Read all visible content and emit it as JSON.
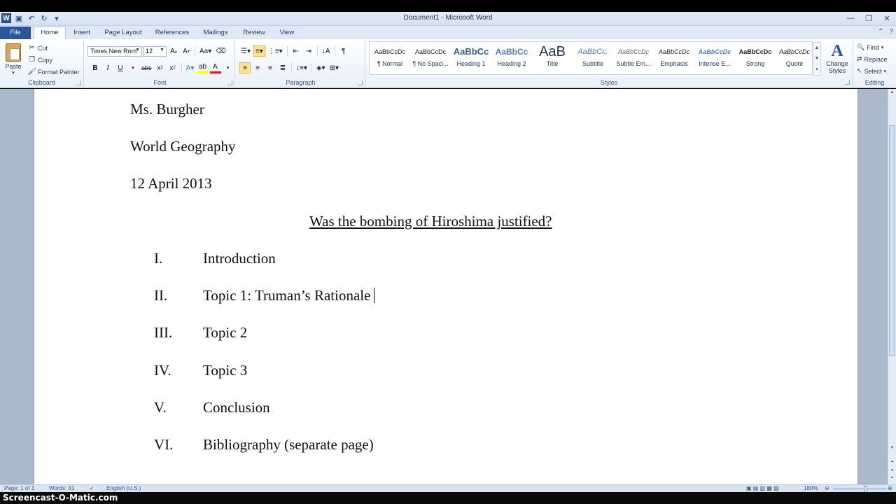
{
  "window": {
    "title": "Document1  -  Microsoft Word",
    "qat_icons": [
      "word-logo-icon",
      "save-icon",
      "undo-icon",
      "redo-icon",
      "customize-qat-icon"
    ],
    "controls": [
      "—",
      "❐",
      "✕"
    ]
  },
  "tabs": [
    "File",
    "Home",
    "Insert",
    "Page Layout",
    "References",
    "Mailings",
    "Review",
    "View"
  ],
  "active_tab": "Home",
  "ribbon": {
    "clipboard": {
      "label": "Clipboard",
      "paste": "Paste",
      "cut": "Cut",
      "copy": "Copy",
      "format_painter": "Format Painter"
    },
    "font": {
      "label": "Font",
      "font_name": "Times New Rom",
      "font_size": "12"
    },
    "paragraph": {
      "label": "Paragraph"
    },
    "styles": {
      "label": "Styles",
      "tiles": [
        {
          "sample": "AaBbCcDc",
          "name": "¶ Normal"
        },
        {
          "sample": "AaBbCcDc",
          "name": "¶ No Spaci..."
        },
        {
          "sample": "AaBbCc",
          "name": "Heading 1"
        },
        {
          "sample": "AaBbCc",
          "name": "Heading 2"
        },
        {
          "sample": "AaB",
          "name": "Title"
        },
        {
          "sample": "AaBbCc.",
          "name": "Subtitle"
        },
        {
          "sample": "AaBbCcDc",
          "name": "Subtle Em..."
        },
        {
          "sample": "AaBbCcDc",
          "name": "Emphasis"
        },
        {
          "sample": "AaBbCcDc",
          "name": "Intense E..."
        },
        {
          "sample": "AaBbCcDc",
          "name": "Strong"
        },
        {
          "sample": "AaBbCcDc",
          "name": "Quote"
        }
      ],
      "change_styles": "Change Styles"
    },
    "editing": {
      "label": "Editing",
      "find": "Find",
      "replace": "Replace",
      "select": "Select"
    }
  },
  "document": {
    "header_lines": [
      "Ms. Burgher",
      "World Geography",
      "12 April 2013"
    ],
    "title": "Was the bombing of Hiroshima justified?",
    "outline": [
      {
        "num": "I.",
        "text": "Introduction"
      },
      {
        "num": "II.",
        "text": "Topic 1: Truman’s Rationale"
      },
      {
        "num": "III.",
        "text": "Topic 2"
      },
      {
        "num": "IV.",
        "text": "Topic 3"
      },
      {
        "num": "V.",
        "text": "Conclusion"
      },
      {
        "num": "VI.",
        "text": "Bibliography (separate page)"
      }
    ]
  },
  "status": {
    "page": "Page: 1 of 1",
    "words": "Words: 31",
    "language": "English (U.S.)",
    "zoom": "180%"
  },
  "watermark": "Screencast-O-Matic.com"
}
